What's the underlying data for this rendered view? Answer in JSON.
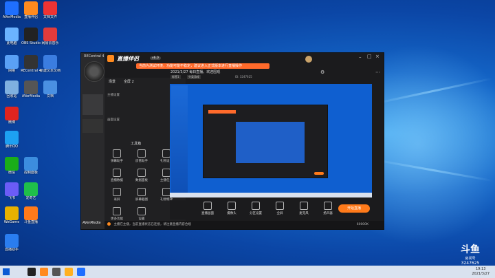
{
  "desktop": {
    "icons": [
      {
        "label": "AVerMedia"
      },
      {
        "label": "直播伴侣"
      },
      {
        "label": "文档文件"
      },
      {
        "label": "此电脑"
      },
      {
        "label": "OBS Studio"
      },
      {
        "label": "网易云音乐"
      },
      {
        "label": "网络"
      },
      {
        "label": "RECentral 4"
      },
      {
        "label": "新建文本文档"
      },
      {
        "label": "回收站"
      },
      {
        "label": "AVerMedia"
      },
      {
        "label": "文档"
      },
      {
        "label": "微博"
      },
      {
        "label": "腾讯QQ"
      },
      {
        "label": "微信"
      },
      {
        "label": "控制面板"
      },
      {
        "label": "飞书"
      },
      {
        "label": "爱奇艺"
      },
      {
        "label": "斗鱼直播"
      },
      {
        "label": "WeGame"
      },
      {
        "label": "直播助手"
      }
    ]
  },
  "app": {
    "left_title": "RECentral 4",
    "panel": {
      "section1": "主播设置",
      "section2": "画面设置",
      "tabs": [
        "场景",
        "全屏 2"
      ]
    },
    "toolbar": {
      "title": "直播伴侣",
      "version": "v6.0",
      "menu": [
        "工具",
        "设备",
        "功能",
        "直播",
        "互动"
      ]
    },
    "warning": "当前为测试环境，功能可能不稳定，建议进入正式版本进行直播操作",
    "room_title": "2021/3/27 每日直播，欢迎围观",
    "tags": [
      "标签1",
      "分类游戏"
    ],
    "room_info": "ID: 3247625",
    "tools_header": "工具箱",
    "tools": [
      "弹幕助手",
      "房管助手",
      "礼物设置",
      "直播数据",
      "数据面板",
      "主播任务",
      "录屏",
      "屏幕截图",
      "礼物特效",
      "更多功能",
      "设置"
    ],
    "controls": [
      "直播画面",
      "摄像头",
      "分区设置",
      "全屏",
      "麦克风",
      "扬声器"
    ],
    "live_button": "开始直播",
    "status": "主播在主播，当前直播状态已连接，请注意直播内容合规",
    "status_right": "60000K"
  },
  "taskbar": {
    "time": "19:13",
    "date": "2021/3/27"
  },
  "watermark": {
    "brand": "斗鱼",
    "sub": "房间号",
    "room": "3247625"
  }
}
